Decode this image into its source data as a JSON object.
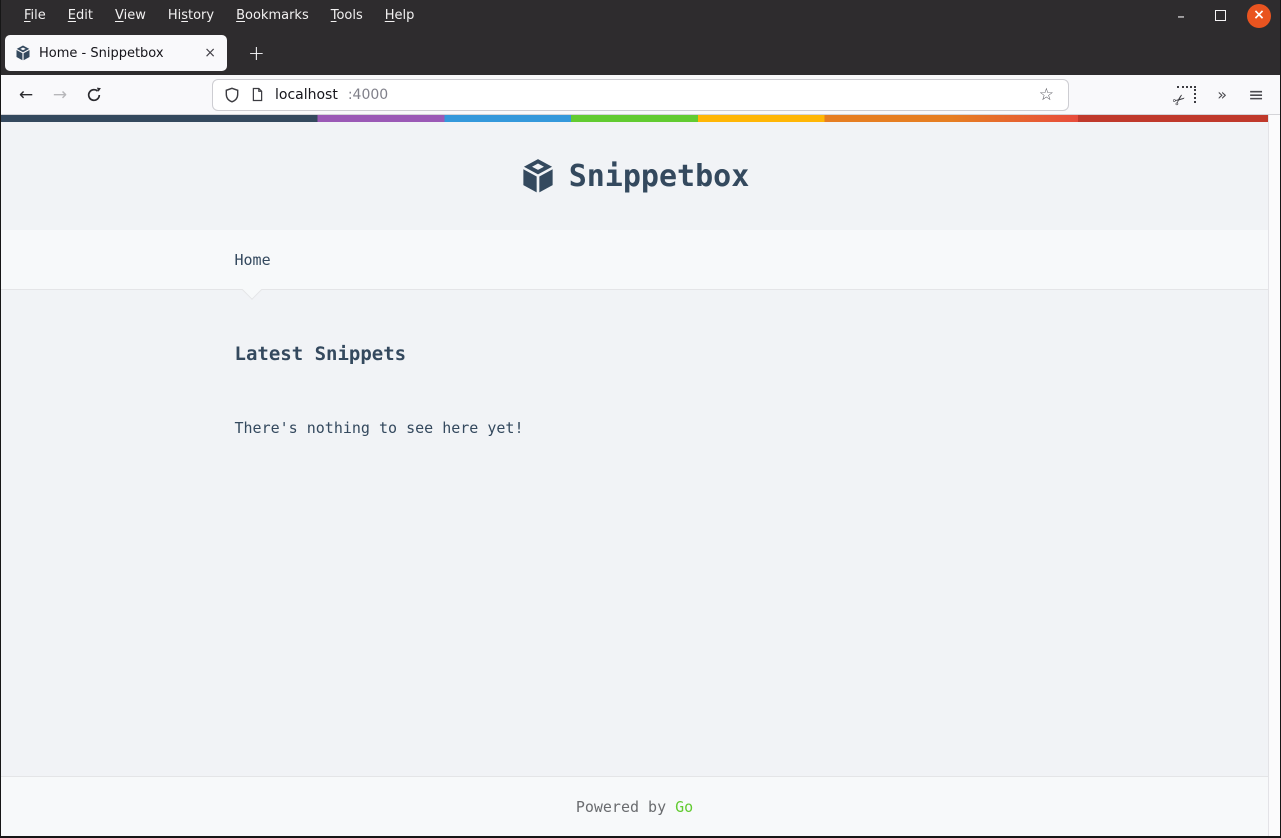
{
  "menubar": {
    "items": [
      {
        "pre": "",
        "m": "F",
        "post": "ile"
      },
      {
        "pre": "",
        "m": "E",
        "post": "dit"
      },
      {
        "pre": "",
        "m": "V",
        "post": "iew"
      },
      {
        "pre": "Hi",
        "m": "s",
        "post": "tory"
      },
      {
        "pre": "",
        "m": "B",
        "post": "ookmarks"
      },
      {
        "pre": "",
        "m": "T",
        "post": "ools"
      },
      {
        "pre": "",
        "m": "H",
        "post": "elp"
      }
    ]
  },
  "window_controls": {
    "minimize": "–",
    "close": "×"
  },
  "tab": {
    "title": "Home - Snippetbox",
    "favicon": "snippetbox-cube-icon"
  },
  "icons": {
    "tab_close": "×",
    "new_tab": "+",
    "back": "←",
    "forward": "→",
    "star": "☆",
    "scissors": "✂",
    "overflow": "»",
    "menu": "≡"
  },
  "urlbar": {
    "host": "localhost",
    "port": ":4000"
  },
  "page": {
    "header": {
      "title": "Snippetbox",
      "logo": "snippetbox-cube-icon"
    },
    "nav": {
      "items": [
        {
          "label": "Home",
          "active": true
        }
      ]
    },
    "main": {
      "heading": "Latest Snippets",
      "empty_message": "There's nothing to see here yet!"
    },
    "footer": {
      "prefix": "Powered by",
      "link_label": "Go"
    }
  },
  "colors": {
    "brand_navy": "#34495E",
    "page_bg": "#F1F3F6",
    "panel_bg": "#F7F9FA",
    "panel_border": "#E4E5E7",
    "muted_text": "#6A6C6F",
    "go_green": "#62CB31",
    "close_orange": "#E95420",
    "chrome_dark": "#2E2C2E",
    "rainbow": [
      "#34495E",
      "#9B59B6",
      "#3498DB",
      "#62CB31",
      "#FFB606",
      "#E67E22",
      "#E74C3C",
      "#C0392B"
    ]
  }
}
